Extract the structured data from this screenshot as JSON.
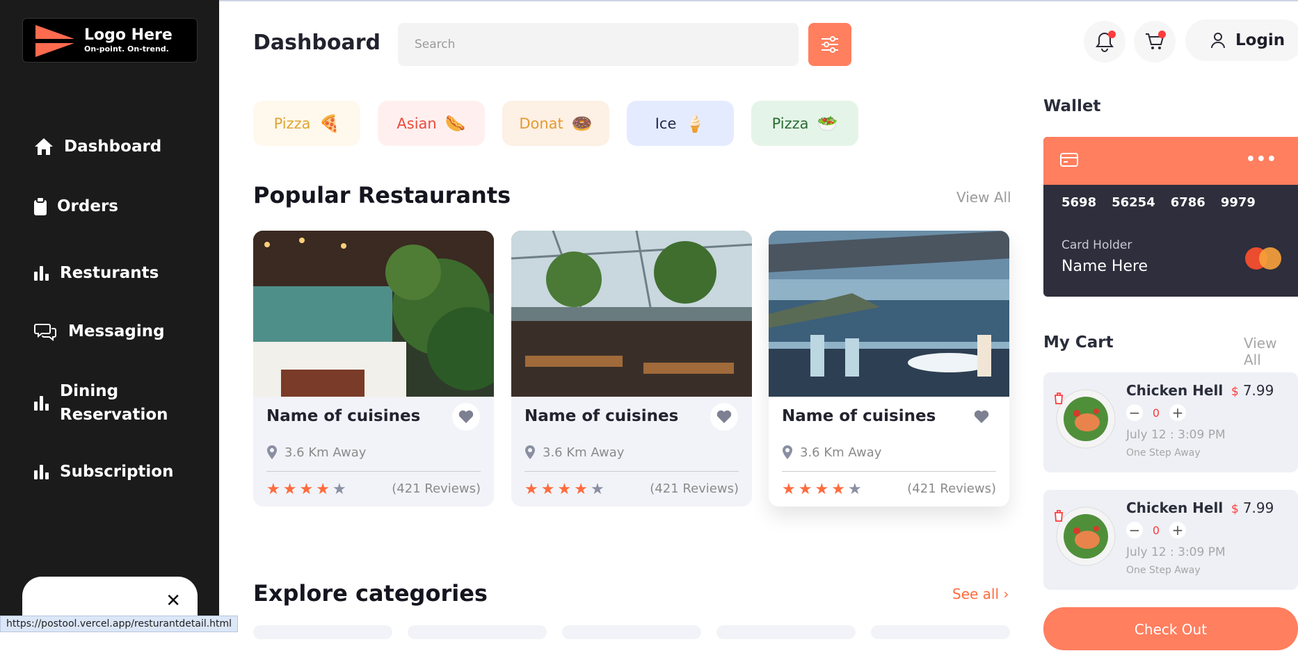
{
  "brand": {
    "title": "Logo Here",
    "tagline": "On-point. On-trend."
  },
  "sidebar": {
    "items": [
      {
        "label": "Dashboard",
        "icon": "home-icon"
      },
      {
        "label": "Orders",
        "icon": "clipboard-icon"
      },
      {
        "label": "Resturants",
        "icon": "bar-chart-icon"
      },
      {
        "label": "Messaging",
        "icon": "chat-icon"
      },
      {
        "label": "Dining Reservation",
        "label_line1": "Dining",
        "label_line2": "Reservation",
        "icon": "bar-chart-icon"
      },
      {
        "label": "Subscription",
        "icon": "bar-chart-icon"
      }
    ],
    "promo_close": "✕"
  },
  "status_bar": {
    "url": "https://postool.vercel.app/resturantdetail.html"
  },
  "header": {
    "title": "Dashboard",
    "search_placeholder": "Search",
    "login_label": "Login"
  },
  "categories_chips": [
    {
      "label": "Pizza",
      "emoji": "🍕",
      "bg": "#fff8ec",
      "color": "#e0a534"
    },
    {
      "label": "Asian",
      "emoji": "🌭",
      "bg": "#fff0ef",
      "color": "#ea4c3c"
    },
    {
      "label": "Donat",
      "emoji": "🍩",
      "bg": "#fdf0e4",
      "color": "#e39b33"
    },
    {
      "label": "Ice",
      "emoji": "🍦",
      "bg": "#e5ebff",
      "color": "#1f2a4a"
    },
    {
      "label": "Pizza",
      "emoji": "🥗",
      "bg": "#e5f4e8",
      "color": "#2b6d35"
    }
  ],
  "popular": {
    "title": "Popular Restaurants",
    "view_all": "View All",
    "cards": [
      {
        "name": "Name of cuisines",
        "distance": "3.6 Km Away",
        "rating": 4,
        "reviews": "(421 Reviews)"
      },
      {
        "name": "Name of cuisines",
        "distance": "3.6 Km Away",
        "rating": 4,
        "reviews": "(421 Reviews)"
      },
      {
        "name": "Name of cuisines",
        "distance": "3.6 Km Away",
        "rating": 4,
        "reviews": "(421 Reviews)"
      }
    ]
  },
  "explore": {
    "title": "Explore categories",
    "see_all": "See all ›"
  },
  "wallet": {
    "title": "Wallet",
    "more": "•••",
    "card_numbers": [
      "5698",
      "56254",
      "6786",
      "9979"
    ],
    "holder_label": "Card Holder",
    "holder_name": "Name Here"
  },
  "cart": {
    "title": "My Cart",
    "view_all": "View All",
    "items": [
      {
        "name": "Chicken Hell",
        "currency": "$",
        "price": "7.99",
        "qty": "0",
        "time": "July 12 : 3:09 PM",
        "note": "One Step Away"
      },
      {
        "name": "Chicken Hell",
        "currency": "$",
        "price": "7.99",
        "qty": "0",
        "time": "July 12 : 3:09 PM",
        "note": "One Step Away"
      }
    ],
    "checkout_label": "Check Out"
  },
  "colors": {
    "accent": "#ff7f5f",
    "sidebar_bg": "#1b1b1b",
    "star_active": "#ff6b3d",
    "star_inactive": "#8a8fa3"
  }
}
